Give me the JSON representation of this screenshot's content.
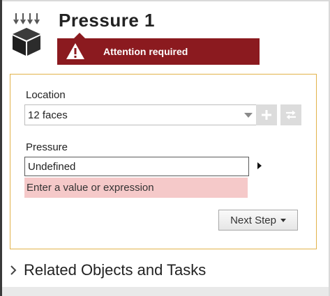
{
  "header": {
    "title": "Pressure 1",
    "icon": "pressure-boundary-icon"
  },
  "alert": {
    "text": "Attention required",
    "icon": "warning-icon",
    "color": "#8b1a1f"
  },
  "panel": {
    "border_color": "#e2b24a",
    "location": {
      "label": "Location",
      "value": "12 faces",
      "add_icon": "plus-icon",
      "swap_icon": "swap-icon"
    },
    "pressure": {
      "label": "Pressure",
      "value": "Undefined",
      "error": "Enter a value or expression",
      "error_color": "#f5c9c9"
    },
    "next_step": {
      "label": "Next Step"
    }
  },
  "related": {
    "label": "Related Objects and Tasks"
  }
}
